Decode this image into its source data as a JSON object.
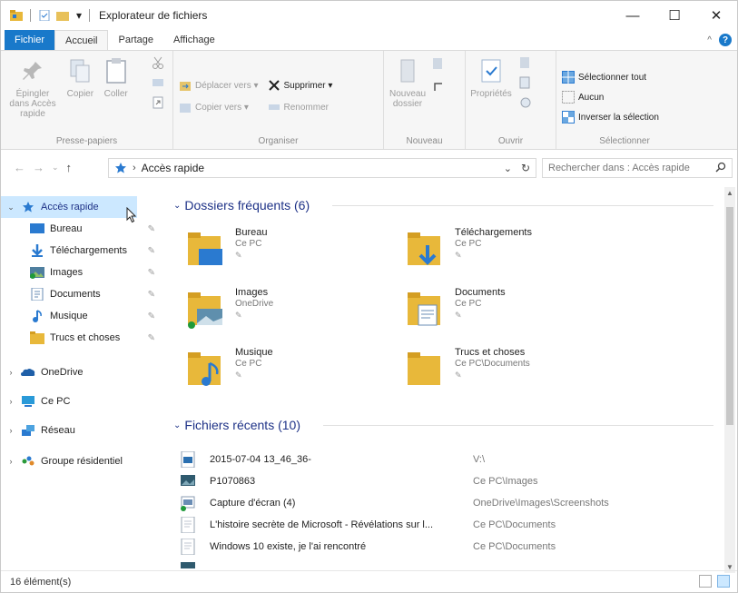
{
  "window": {
    "title": "Explorateur de fichiers",
    "controls": {
      "minimize": "—",
      "maximize": "☐",
      "close": "✕"
    }
  },
  "tabs": {
    "file": "Fichier",
    "home": "Accueil",
    "share": "Partage",
    "view": "Affichage"
  },
  "ribbon": {
    "clipboard": {
      "label": "Presse-papiers",
      "pin": "Épingler dans Accès rapide",
      "copy": "Copier",
      "paste": "Coller"
    },
    "organize": {
      "label": "Organiser",
      "move_to": "Déplacer vers ▾",
      "copy_to": "Copier vers ▾",
      "delete": "Supprimer ▾",
      "rename": "Renommer"
    },
    "new": {
      "label": "Nouveau",
      "new_folder": "Nouveau dossier"
    },
    "open": {
      "label": "Ouvrir",
      "properties": "Propriétés"
    },
    "select": {
      "label": "Sélectionner",
      "select_all": "Sélectionner tout",
      "none": "Aucun",
      "invert": "Inverser la sélection"
    }
  },
  "address": {
    "path": "Accès rapide",
    "search_placeholder": "Rechercher dans : Accès rapide"
  },
  "nav": {
    "quick_access": "Accès rapide",
    "pinned": [
      {
        "label": "Bureau",
        "icon": "desktop-icon"
      },
      {
        "label": "Téléchargements",
        "icon": "download-icon"
      },
      {
        "label": "Images",
        "icon": "images-icon"
      },
      {
        "label": "Documents",
        "icon": "documents-icon"
      },
      {
        "label": "Musique",
        "icon": "music-icon"
      },
      {
        "label": "Trucs et choses",
        "icon": "folder-icon"
      }
    ],
    "onedrive": "OneDrive",
    "this_pc": "Ce PC",
    "network": "Réseau",
    "homegroup": "Groupe résidentiel"
  },
  "frequent": {
    "header": "Dossiers fréquents (6)",
    "items": [
      {
        "name": "Bureau",
        "location": "Ce PC"
      },
      {
        "name": "Téléchargements",
        "location": "Ce PC"
      },
      {
        "name": "Images",
        "location": "OneDrive"
      },
      {
        "name": "Documents",
        "location": "Ce PC"
      },
      {
        "name": "Musique",
        "location": "Ce PC"
      },
      {
        "name": "Trucs et choses",
        "location": "Ce PC\\Documents"
      }
    ]
  },
  "recent": {
    "header": "Fichiers récents (10)",
    "items": [
      {
        "name": "2015-07-04 13_46_36-",
        "path": "V:\\"
      },
      {
        "name": "P1070863",
        "path": "Ce PC\\Images"
      },
      {
        "name": "Capture d'écran (4)",
        "path": "OneDrive\\Images\\Screenshots"
      },
      {
        "name": "L'histoire secrète de Microsoft - Révélations sur l...",
        "path": "Ce PC\\Documents"
      },
      {
        "name": "Windows 10 existe, je l'ai rencontré",
        "path": "Ce PC\\Documents"
      }
    ]
  },
  "status": {
    "count": "16 élément(s)"
  },
  "colors": {
    "accent": "#1979ca",
    "selection": "#cce8ff",
    "section_header": "#1e3287"
  }
}
